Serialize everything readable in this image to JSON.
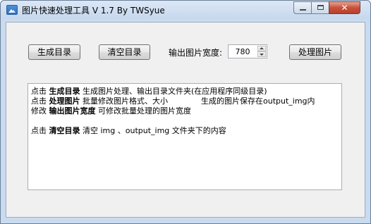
{
  "window": {
    "title": "图片快速处理工具 V 1.7 By TWSyue",
    "icon": "picture-icon",
    "controls": {
      "close_glyph": "✕"
    }
  },
  "toolbar": {
    "generate_label": "生成目录",
    "clear_label": "清空目录",
    "width_label": "输出图片宽度:",
    "width_value": "780",
    "process_label": "处理图片"
  },
  "info": {
    "line1": {
      "prefix": "点击",
      "keyword": "生成目录",
      "text": "生成图片处理、输出目录文件夹(在应用程序同级目录)"
    },
    "line2": {
      "prefix": "点击",
      "keyword": "处理图片",
      "text": "批量修改图片格式、大小",
      "text2": "生成的图片保存在output_img内"
    },
    "line3": {
      "prefix": "修改",
      "keyword": "输出图片宽度",
      "text": "可修改批量处理的图片宽度"
    },
    "line4": {
      "prefix": "点击",
      "keyword": "清空目录",
      "text": "清空 img 、output_img 文件夹下的内容"
    }
  },
  "colors": {
    "frame": "#c9dbef",
    "client": "#f0f0f0",
    "close_button": "#c7513b"
  }
}
